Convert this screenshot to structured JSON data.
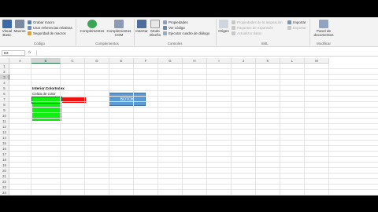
{
  "ribbon": {
    "code_group": {
      "visual_basic": "Visual Basic",
      "macros": "Macros",
      "record_macro": "Grabar macro",
      "relative_refs": "Usar referencias relativas",
      "macro_security": "Seguridad de macros",
      "label": "Código"
    },
    "addins_group": {
      "addins": "Complementos",
      "com_addins": "Complementos COM",
      "label": "Complementos"
    },
    "controls_group": {
      "insert": "Insertar",
      "design_mode": "Modo Diseño",
      "properties": "Propiedades",
      "view_code": "Ver código",
      "run_dialog": "Ejecutar cuadro de diálogo",
      "label": "Controles"
    },
    "xml_group": {
      "source": "Origen",
      "map_properties": "Propiedades de la asignación",
      "expansion_packs": "Paquetes de expansión",
      "refresh_data": "Actualizar datos",
      "import": "Importar",
      "export": "Exportar",
      "label": "XML"
    },
    "modify_group": {
      "doc_panel": "Panel de documentos",
      "label": "Modificar"
    }
  },
  "formula_bar": {
    "name_box": "B3",
    "fx": "fx",
    "content": ""
  },
  "sheet": {
    "columns": [
      "A",
      "B",
      "C",
      "D",
      "E",
      "F",
      "G",
      "H",
      "I",
      "J",
      "K",
      "L",
      "M"
    ],
    "selected_column": "B",
    "rows": [
      "1",
      "2",
      "3",
      "4",
      "5",
      "6",
      "7",
      "8",
      "9",
      "10",
      "11",
      "12",
      "13",
      "14",
      "15",
      "16",
      "17",
      "18",
      "19",
      "20",
      "21",
      "22",
      "23",
      "24"
    ],
    "selected_row": "3",
    "cells": {
      "b1": "Interior.ColorIndex",
      "b2": "Celda de color"
    },
    "button_label": "BOTON",
    "colors": {
      "red_cell": "#ee1111",
      "green_cell": "#11ee11",
      "button": "#5b9bd5",
      "selection": "#217346"
    }
  }
}
